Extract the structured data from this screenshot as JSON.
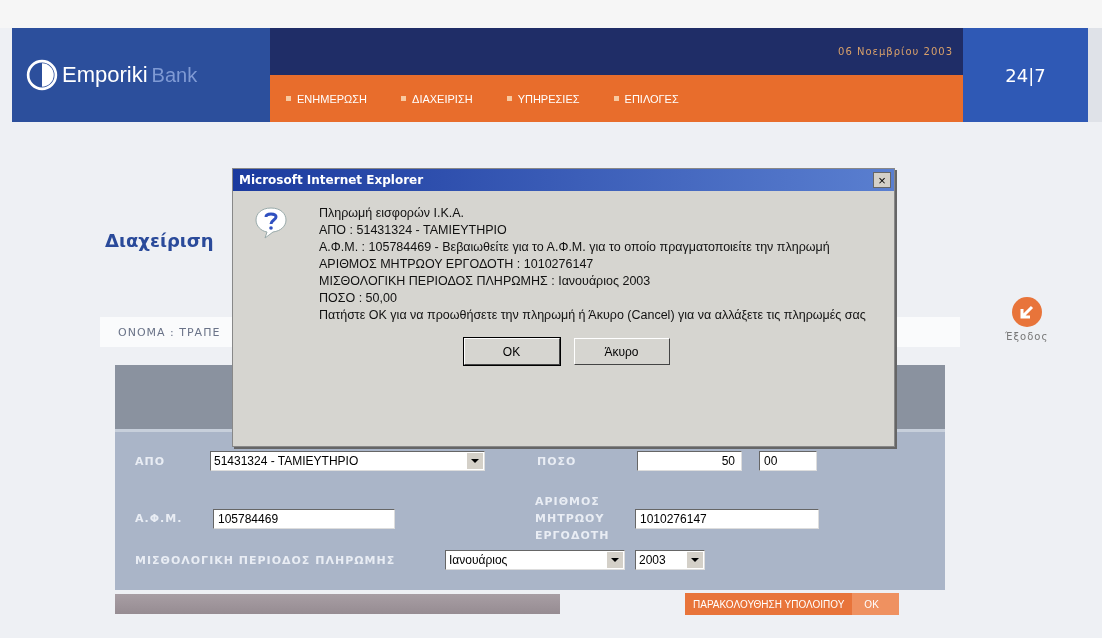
{
  "header": {
    "logo": {
      "name": "Emporiki",
      "suffix": "Bank"
    },
    "date": "06 Νοεμβρίου 2003",
    "menu": [
      "ΕΝΗΜΕΡΩΣΗ",
      "ΔΙΑΧΕΙΡΙΣΗ",
      "ΥΠΗΡΕΣΙΕΣ",
      "ΕΠΙΛΟΓΕΣ"
    ],
    "badge": "24|7"
  },
  "page": {
    "title": "Διαχείριση",
    "name_line": "ΟΝΟΜΑ : ΤΡΑΠΕ",
    "exit": "Έξοδος"
  },
  "form": {
    "from_label": "ΑΠΟ",
    "from_value": "51431324 - ΤΑΜΙΕΥΤΗΡΙΟ",
    "amount_label": "ΠΟΣΟ",
    "amount_value": "50",
    "cents_value": "00",
    "afm_label": "Α.Φ.Μ.",
    "afm_value": "105784469",
    "employer_label": "ΑΡΙΘΜΟΣ ΜΗΤΡΩΟΥ ΕΡΓΟΔΟΤΗ",
    "employer_value": "1010276147",
    "period_label": "ΜΙΣΘΟΛΟΓΙΚΗ ΠΕΡΙΟΔΟΣ ΠΛΗΡΩΜΗΣ",
    "month_value": "Ιανουάριος",
    "year_value": "2003"
  },
  "bottom_bar": {
    "link": "ΠΑΡΑΚΟΛΟΥΘΗΣΗ ΥΠΟΛΟΙΠΟΥ",
    "ok": "OK"
  },
  "dialog": {
    "title": "Microsoft Internet Explorer",
    "close": "×",
    "lines": [
      "Πληρωμή εισφορών Ι.Κ.Α.",
      "ΑΠΟ : 51431324 - ΤΑΜΙΕΥΤΗΡΙΟ",
      "Α.Φ.Μ. : 105784469 - Βεβαιωθείτε για το Α.Φ.Μ. για το οποίο πραγματοποιείτε την πληρωμή",
      "ΑΡΙΘΜΟΣ ΜΗΤΡΩΟΥ ΕΡΓΟΔΟΤΗ : 1010276147",
      "ΜΙΣΘΟΛΟΓΙΚΗ ΠΕΡΙΟΔΟΣ ΠΛΗΡΩΜΗΣ : Ιανουάριος 2003",
      "ΠΟΣΟ : 50,00",
      "Πατήστε OK για να προωθήσετε την πληρωμή ή Άκυρο (Cancel) για να αλλάξετε τις πληρωμές σας"
    ],
    "buttons": [
      "OK",
      "Άκυρο"
    ]
  }
}
